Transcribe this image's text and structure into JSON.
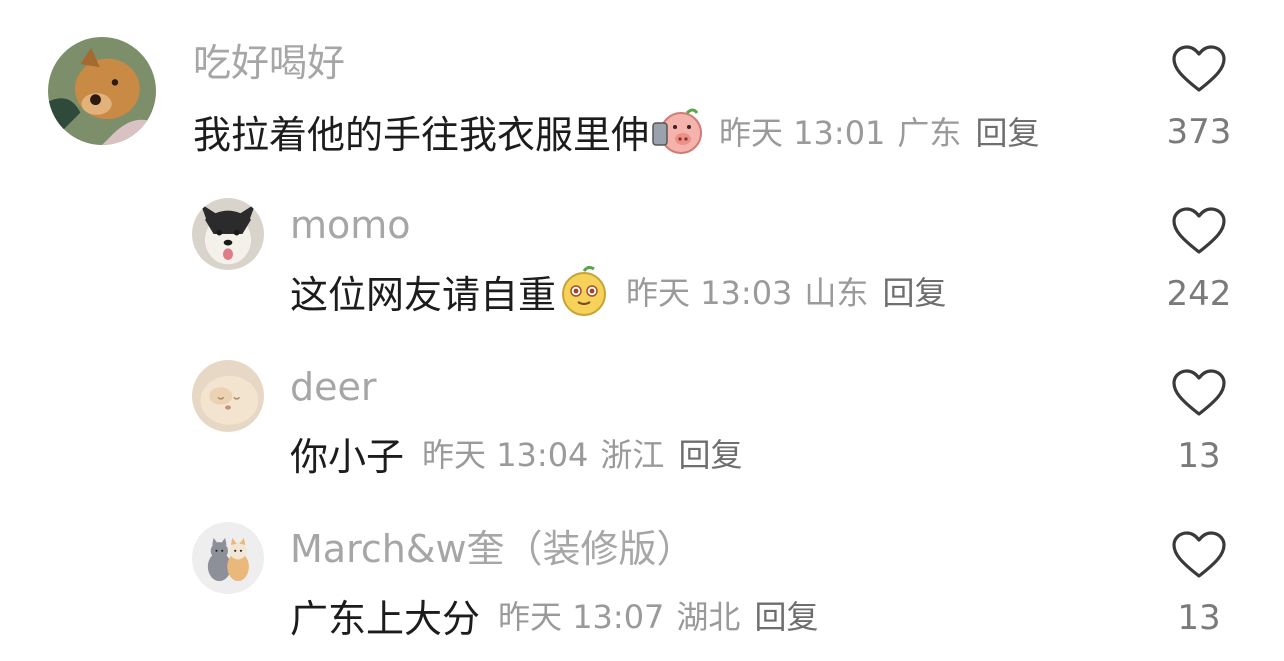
{
  "comments": [
    {
      "username": "吃好喝好",
      "text": "我拉着他的手往我衣服里伸",
      "emoji": "pig-kiss-emoji",
      "time": "昨天 13:01",
      "location": "广东",
      "reply_label": "回复",
      "likes": "373"
    },
    {
      "username": "momo",
      "text": "这位网友请自重",
      "emoji": "smug-face-emoji",
      "time": "昨天 13:03",
      "location": "山东",
      "reply_label": "回复",
      "likes": "242"
    },
    {
      "username": "deer",
      "text": "你小子",
      "time": "昨天 13:04",
      "location": "浙江",
      "reply_label": "回复",
      "likes": "13"
    },
    {
      "username": "March&w奎（装修版）",
      "text": "广东上大分",
      "time": "昨天 13:07",
      "location": "湖北",
      "reply_label": "回复",
      "likes": "13"
    }
  ],
  "colors": {
    "username": "#a6a6a6",
    "text": "#1c1c1c",
    "meta": "#9a9a9a",
    "heart_stroke": "#3a3a3a"
  }
}
